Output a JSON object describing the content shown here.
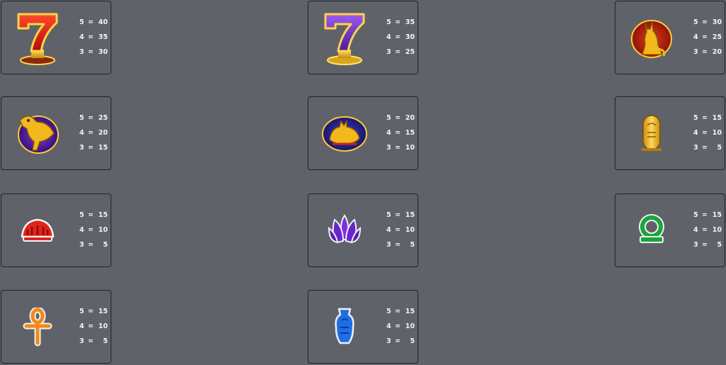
{
  "paytable": [
    {
      "symbol": "red-seven-icon",
      "pays": [
        {
          "count": "5",
          "value": "40"
        },
        {
          "count": "4",
          "value": "35"
        },
        {
          "count": "3",
          "value": "30"
        }
      ]
    },
    {
      "symbol": "purple-seven-icon",
      "pays": [
        {
          "count": "5",
          "value": "35"
        },
        {
          "count": "4",
          "value": "30"
        },
        {
          "count": "3",
          "value": "25"
        }
      ]
    },
    {
      "symbol": "cat-icon",
      "pays": [
        {
          "count": "5",
          "value": "30"
        },
        {
          "count": "4",
          "value": "25"
        },
        {
          "count": "3",
          "value": "20"
        }
      ]
    },
    {
      "symbol": "falcon-icon",
      "pays": [
        {
          "count": "5",
          "value": "25"
        },
        {
          "count": "4",
          "value": "20"
        },
        {
          "count": "3",
          "value": "15"
        }
      ]
    },
    {
      "symbol": "lying-cat-icon",
      "pays": [
        {
          "count": "5",
          "value": "20"
        },
        {
          "count": "4",
          "value": "15"
        },
        {
          "count": "3",
          "value": "10"
        }
      ]
    },
    {
      "symbol": "cartouche-icon",
      "pays": [
        {
          "count": "5",
          "value": "15"
        },
        {
          "count": "4",
          "value": "10"
        },
        {
          "count": "3",
          "value": "5"
        }
      ]
    },
    {
      "symbol": "red-headdress-icon",
      "pays": [
        {
          "count": "5",
          "value": "15"
        },
        {
          "count": "4",
          "value": "10"
        },
        {
          "count": "3",
          "value": "5"
        }
      ]
    },
    {
      "symbol": "purple-lotus-icon",
      "pays": [
        {
          "count": "5",
          "value": "15"
        },
        {
          "count": "4",
          "value": "10"
        },
        {
          "count": "3",
          "value": "5"
        }
      ]
    },
    {
      "symbol": "green-shen-ring-icon",
      "pays": [
        {
          "count": "5",
          "value": "15"
        },
        {
          "count": "4",
          "value": "10"
        },
        {
          "count": "3",
          "value": "5"
        }
      ]
    },
    {
      "symbol": "ankh-icon",
      "pays": [
        {
          "count": "5",
          "value": "15"
        },
        {
          "count": "4",
          "value": "10"
        },
        {
          "count": "3",
          "value": "5"
        }
      ]
    },
    {
      "symbol": "blue-vase-icon",
      "pays": [
        {
          "count": "5",
          "value": "15"
        },
        {
          "count": "4",
          "value": "10"
        },
        {
          "count": "3",
          "value": "5"
        }
      ]
    }
  ],
  "separator": "=",
  "colors": {
    "background": "#5f6369",
    "card_border": "#1f2226",
    "text": "#f2f2f2"
  }
}
